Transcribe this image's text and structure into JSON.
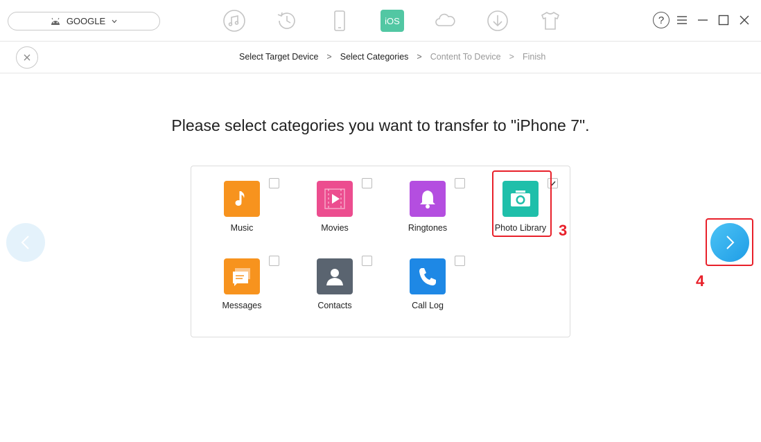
{
  "header": {
    "device_name": "GOOGLE",
    "tools": [
      {
        "icon": "music-note-icon"
      },
      {
        "icon": "history-icon"
      },
      {
        "icon": "phone-icon"
      },
      {
        "icon": "ios-mover-icon",
        "label": "iOS"
      },
      {
        "icon": "cloud-icon"
      },
      {
        "icon": "download-icon"
      },
      {
        "icon": "tshirt-icon"
      }
    ],
    "help_label": "?"
  },
  "steps": [
    {
      "label": "Select Target Device",
      "state": "done"
    },
    {
      "label": "Select Categories",
      "state": "current"
    },
    {
      "label": "Content To Device",
      "state": "pending"
    },
    {
      "label": "Finish",
      "state": "pending"
    }
  ],
  "step_separator": ">",
  "heading": "Please select categories you want to transfer to \"iPhone 7\".",
  "categories": [
    {
      "label": "Music",
      "icon": "music-icon",
      "color": "#f7931e",
      "checked": false
    },
    {
      "label": "Movies",
      "icon": "movies-icon",
      "color": "#ec4d8f",
      "checked": false
    },
    {
      "label": "Ringtones",
      "icon": "bell-icon",
      "color": "#b44ee0",
      "checked": false
    },
    {
      "label": "Photo Library",
      "icon": "camera-icon",
      "color": "#1fbfaa",
      "checked": true
    },
    {
      "label": "Messages",
      "icon": "message-icon",
      "color": "#f7931e",
      "checked": false
    },
    {
      "label": "Contacts",
      "icon": "contact-icon",
      "color": "#5a6470",
      "checked": false
    },
    {
      "label": "Call Log",
      "icon": "phone-call-icon",
      "color": "#1e88e5",
      "checked": false
    }
  ],
  "annotations": {
    "step3": "3",
    "step4": "4"
  },
  "colors": {
    "accent": "#2aa8ec",
    "annotation": "#e8202a"
  }
}
